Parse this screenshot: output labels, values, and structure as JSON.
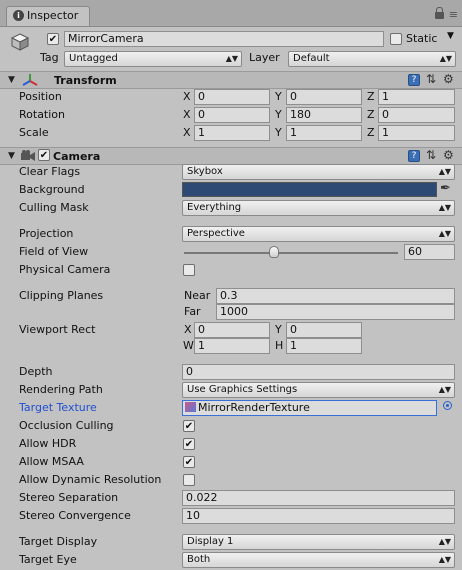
{
  "tab": {
    "label": "Inspector"
  },
  "object": {
    "name": "MirrorCamera",
    "static_label": "Static",
    "tag_label": "Tag",
    "tag_value": "Untagged",
    "layer_label": "Layer",
    "layer_value": "Default"
  },
  "transform": {
    "title": "Transform",
    "rows": [
      {
        "label": "Position",
        "x": "0",
        "y": "0",
        "z": "1"
      },
      {
        "label": "Rotation",
        "x": "0",
        "y": "180",
        "z": "0"
      },
      {
        "label": "Scale",
        "x": "1",
        "y": "1",
        "z": "1"
      }
    ]
  },
  "axes": {
    "x": "X",
    "y": "Y",
    "z": "Z",
    "w": "W",
    "h": "H"
  },
  "camera": {
    "title": "Camera",
    "clear_flags": {
      "label": "Clear Flags",
      "value": "Skybox"
    },
    "background": {
      "label": "Background",
      "color": "#2c4a74"
    },
    "culling_mask": {
      "label": "Culling Mask",
      "value": "Everything"
    },
    "projection": {
      "label": "Projection",
      "value": "Perspective"
    },
    "fov": {
      "label": "Field of View",
      "value": "60",
      "slider_fraction": 0.42
    },
    "physical_camera": {
      "label": "Physical Camera",
      "checked": false
    },
    "clipping": {
      "label": "Clipping Planes",
      "near_label": "Near",
      "near": "0.3",
      "far_label": "Far",
      "far": "1000"
    },
    "viewport": {
      "label": "Viewport Rect",
      "x": "0",
      "y": "0",
      "w": "1",
      "h": "1"
    },
    "depth": {
      "label": "Depth",
      "value": "0"
    },
    "rendering_path": {
      "label": "Rendering Path",
      "value": "Use Graphics Settings"
    },
    "target_texture": {
      "label": "Target Texture",
      "value": "MirrorRenderTexture"
    },
    "occlusion_culling": {
      "label": "Occlusion Culling",
      "checked": true
    },
    "allow_hdr": {
      "label": "Allow HDR",
      "checked": true
    },
    "allow_msaa": {
      "label": "Allow MSAA",
      "checked": true
    },
    "allow_dynamic_resolution": {
      "label": "Allow Dynamic Resolution",
      "checked": false
    },
    "stereo_separation": {
      "label": "Stereo Separation",
      "value": "0.022"
    },
    "stereo_convergence": {
      "label": "Stereo Convergence",
      "value": "10"
    },
    "target_display": {
      "label": "Target Display",
      "value": "Display 1"
    },
    "target_eye": {
      "label": "Target Eye",
      "value": "Both"
    }
  },
  "colors": {
    "accent_label": "#1f4fd0",
    "help": "#3a6fb5",
    "background_swatch": "#2c4a74"
  },
  "icons": [
    "inspector-icon",
    "lock-icon",
    "menu-icon",
    "gameobject-icon",
    "transform-icon",
    "camera-icon",
    "help-icon",
    "preset-icon",
    "gear-icon",
    "eyedropper-icon",
    "object-picker-icon",
    "render-texture-icon"
  ]
}
